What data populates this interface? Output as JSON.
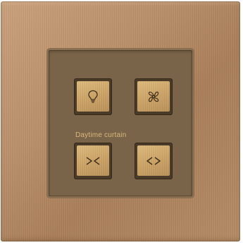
{
  "panel": {
    "label": "Daytime curtain",
    "buttons": [
      {
        "name": "light-button",
        "icon": "lightbulb-icon"
      },
      {
        "name": "fan-button",
        "icon": "fan-icon"
      },
      {
        "name": "curtain-close-button",
        "icon": "curtain-close-icon"
      },
      {
        "name": "curtain-open-button",
        "icon": "curtain-open-icon"
      }
    ]
  },
  "colors": {
    "plate": "#b98e67",
    "panel": "#7a6449",
    "button_face": "#cca264",
    "label_text": "#d9b77c",
    "icon": "#3f2e1a"
  }
}
